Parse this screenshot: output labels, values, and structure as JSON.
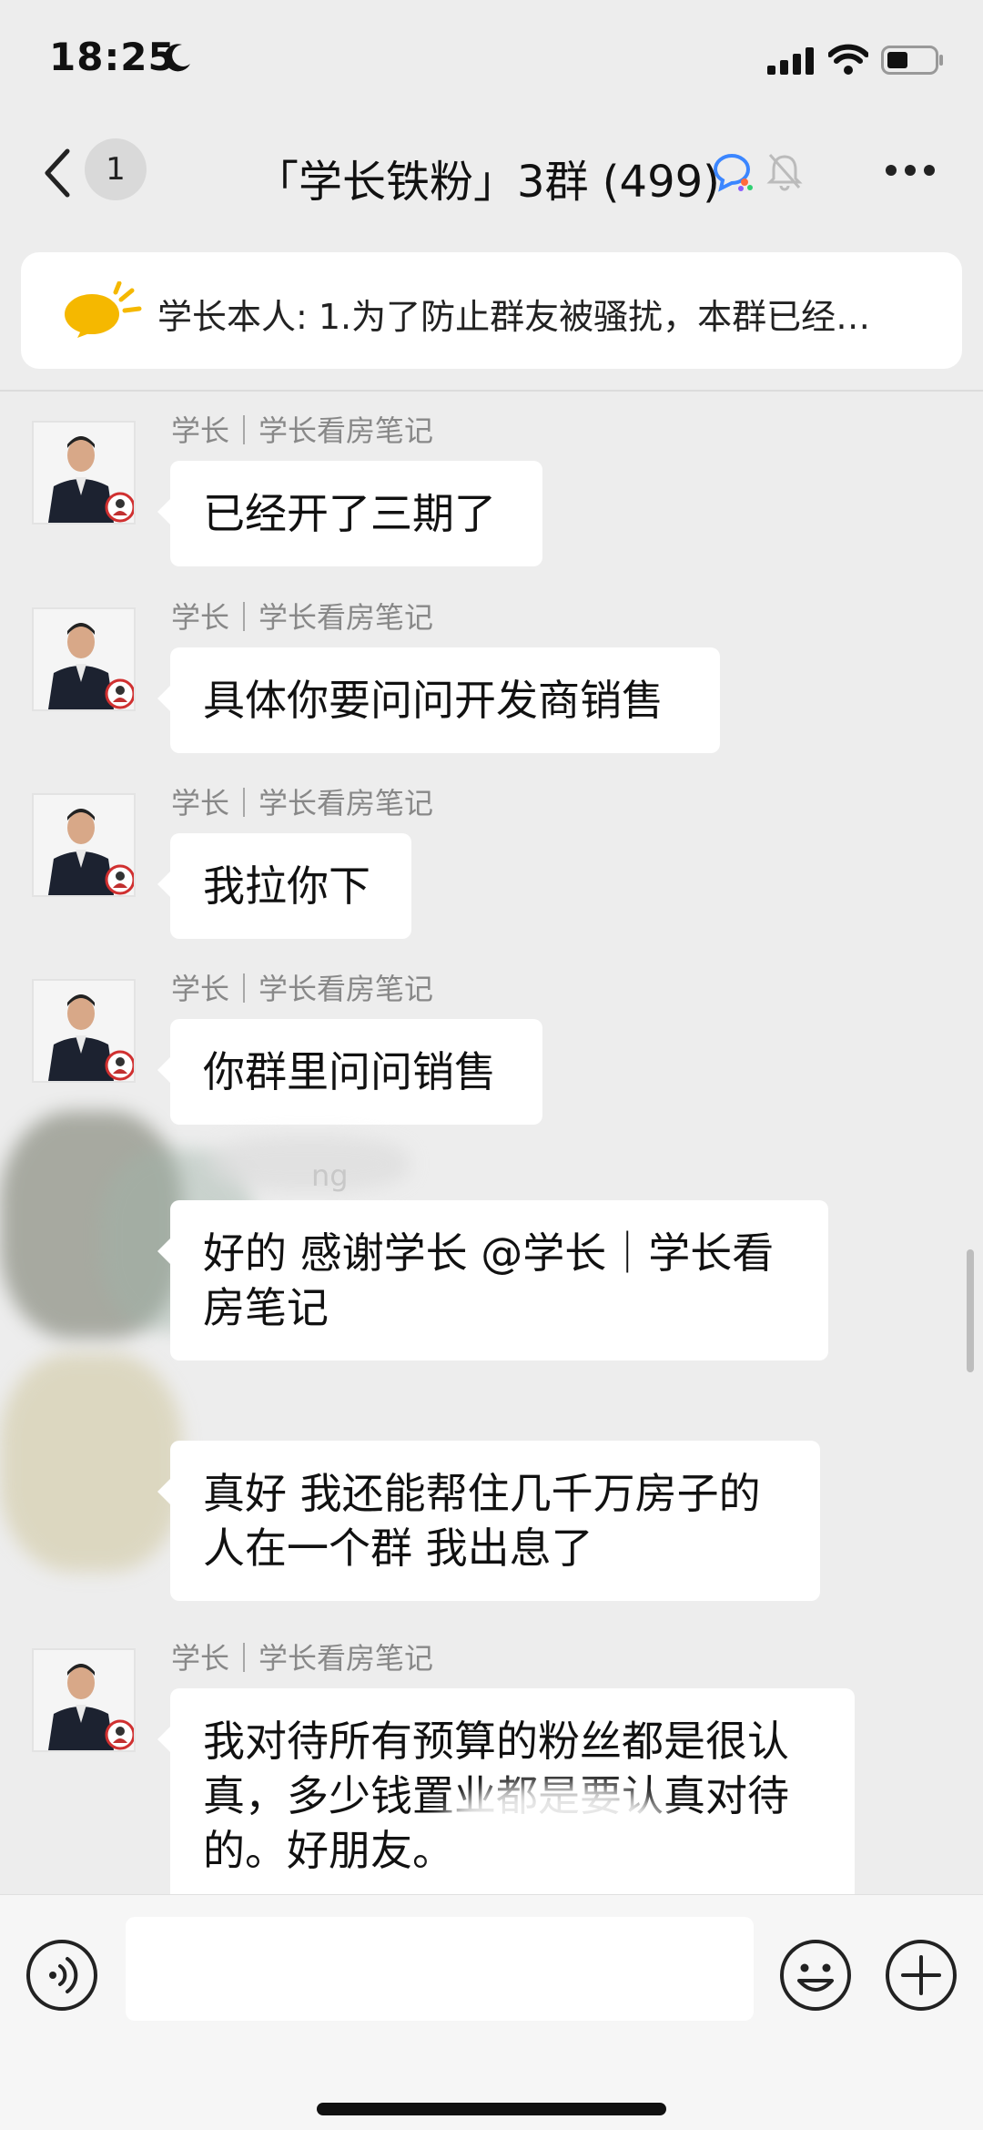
{
  "status_bar": {
    "time": "18:25",
    "icons": [
      "moon-icon",
      "signal-icon",
      "wifi-icon",
      "battery-icon"
    ]
  },
  "nav": {
    "unread_count": "1",
    "title": "「学长铁粉」3群 (499)",
    "icons": [
      "back-icon",
      "ai-chat-icon",
      "mute-bell-icon",
      "more-icon"
    ]
  },
  "announcement": {
    "text": "学长本人: 1.为了防止群友被骚扰，本群已经…",
    "icon": "megaphone-icon"
  },
  "messages": [
    {
      "sender": "学长｜学长看房笔记",
      "text": "已经开了三期了"
    },
    {
      "sender": "学长｜学长看房笔记",
      "text": "具体你要问问开发商销售"
    },
    {
      "sender": "学长｜学长看房笔记",
      "text": "我拉你下"
    },
    {
      "sender": "学长｜学长看房笔记",
      "text": "你群里问问销售"
    },
    {
      "sender": "ng",
      "text": "好的 感谢学长 @学长｜学长看房笔记"
    },
    {
      "sender": "",
      "text": "真好 我还能帮住几千万房子的人在一个群 我出息了"
    },
    {
      "sender": "学长｜学长看房笔记",
      "text": "我对待所有预算的粉丝都是很认真，多少钱置业都是要认真对待的。好朋友。"
    }
  ],
  "input": {
    "placeholder": "",
    "icons": [
      "voice-icon",
      "emoji-icon",
      "plus-icon"
    ]
  },
  "colors": {
    "background": "#ededed",
    "bubble": "#ffffff",
    "name_text": "#888888",
    "announce_yellow": "#f5b800"
  }
}
